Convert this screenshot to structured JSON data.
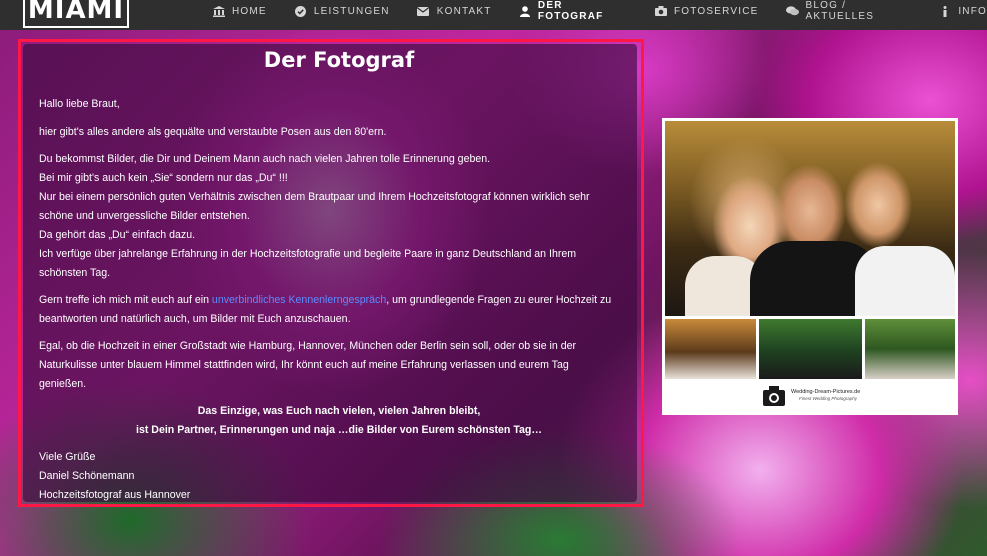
{
  "header": {
    "logo": "MIAMI",
    "nav": [
      {
        "label": "HOME",
        "icon": "bank-icon"
      },
      {
        "label": "LEISTUNGEN",
        "icon": "check-circle-icon"
      },
      {
        "label": "KONTAKT",
        "icon": "envelope-icon"
      },
      {
        "label": "DER FOTOGRAF",
        "icon": "user-icon",
        "active": true
      },
      {
        "label": "FOTOSERVICE",
        "icon": "camera-icon"
      },
      {
        "label": "BLOG / AKTUELLES",
        "icon": "comments-icon"
      },
      {
        "label": "INFO",
        "icon": "info-icon"
      }
    ]
  },
  "main": {
    "title": "Der Fotograf",
    "greeting": "Hallo liebe Braut,",
    "p1": "hier gibt's alles andere als gequälte und verstaubte Posen aus den 80'ern.",
    "p2_lines": [
      "Du bekommst Bilder, die Dir und Deinem Mann auch nach vielen Jahren tolle Erinnerung geben.",
      "Bei mir gibt's auch kein „Sie“ sondern nur das „Du“ !!!",
      "Nur bei einem persönlich guten Verhältnis zwischen dem Brautpaar und Ihrem Hochzeitsfotograf können wirklich sehr",
      "schöne und unvergessliche Bilder entstehen.",
      "Da gehört das „Du“ einfach dazu.",
      "Ich verfüge über jahrelange Erfahrung in der Hochzeitsfotografie und begleite Paare in ganz Deutschland an Ihrem",
      "schönsten Tag."
    ],
    "p3_before": "Gern treffe ich mich mit euch auf ein ",
    "p3_link": "unverbindliches Kennenlerngespräch",
    "p3_after": ", um grundlegende Fragen zu eurer Hochzeit zu",
    "p3_line2": "beantworten und natürlich auch, um Bilder mit Euch anzuschauen.",
    "p4_lines": [
      "Egal, ob die Hochzeit in einer Großstadt wie Hamburg, Hannover, München oder Berlin sein soll, oder ob sie in der",
      "Naturkulisse unter blauem Himmel stattfinden wird, Ihr könnt euch auf meine Erfahrung verlassen und eurem Tag",
      "genießen."
    ],
    "quote_lines": [
      "Das Einzige, was Euch nach vielen, vielen Jahren bleibt,",
      "ist Dein Partner, Erinnerungen und naja …die Bilder von Eurem schönsten Tag…"
    ],
    "signature": [
      "Viele Grüße",
      "Daniel Schönemann",
      "Hochzeitsfotograf aus Hannover"
    ]
  },
  "photo": {
    "logo_name": "Wedding-Dream-Pictures.de",
    "logo_tag": "Finest Wedding Photography"
  },
  "colors": {
    "nav_bg": "#2f2f2f",
    "highlight_outline": "#ff1845",
    "link": "#5b8bff"
  }
}
